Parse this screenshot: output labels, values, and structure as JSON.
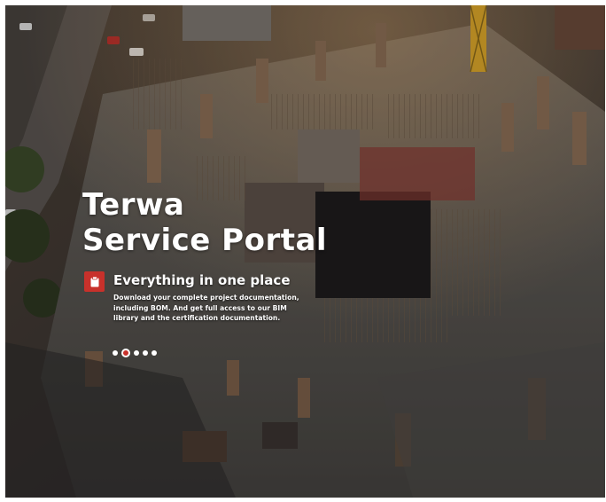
{
  "hero": {
    "title_line1": "Terwa",
    "title_line2": "Service Portal",
    "slide_icon": "clipboard-icon",
    "slide_heading": "Everything in one place",
    "slide_text": "Download your complete project documentation, including BOM. And get full access to our BIM library and the certification documentation."
  },
  "carousel": {
    "slide_count": 5,
    "active_index": 1
  },
  "colors": {
    "accent": "#c8312b",
    "text": "#ffffff"
  }
}
